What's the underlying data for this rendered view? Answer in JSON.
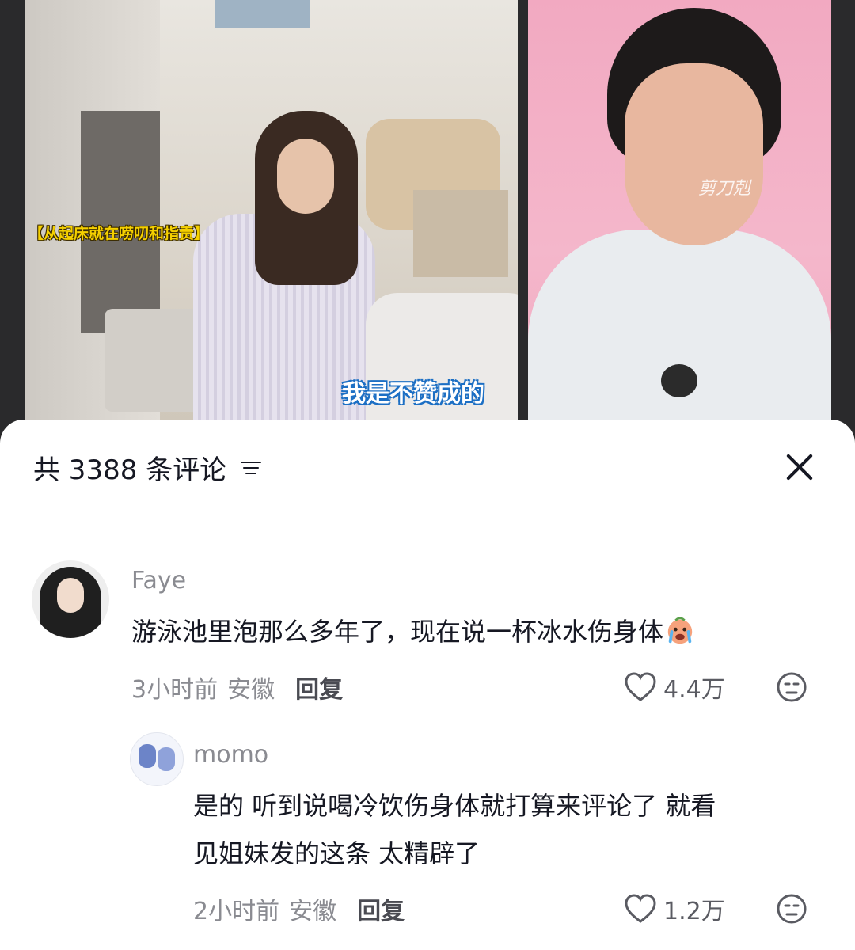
{
  "video": {
    "left_subtitle": "【从起床就在唠叨和指责】",
    "right_subtitle": "我是不赞成的",
    "watermark": "剪刀剋"
  },
  "comments_header": {
    "title": "共 3388 条评论"
  },
  "comments": [
    {
      "username": "Faye",
      "text": "游泳池里泡那么多年了，现在说一杯冰水伤身体",
      "emoji": "crying-face-emoji",
      "time": "3小时前",
      "location": "安徽",
      "reply_label": "回复",
      "likes": "4.4万"
    },
    {
      "username": "momo",
      "text_line1": "是的  听到说喝冷饮伤身体就打算来评论了  就看",
      "text_line2": "见姐妹发的这条  太精辟了",
      "time": "2小时前",
      "location": "安徽",
      "reply_label": "回复",
      "likes": "1.2万"
    }
  ],
  "colors": {
    "text_primary": "#161823",
    "text_secondary": "#8a8b91",
    "sheet_background": "#ffffff",
    "pink_backdrop": "#f4b7cb"
  }
}
